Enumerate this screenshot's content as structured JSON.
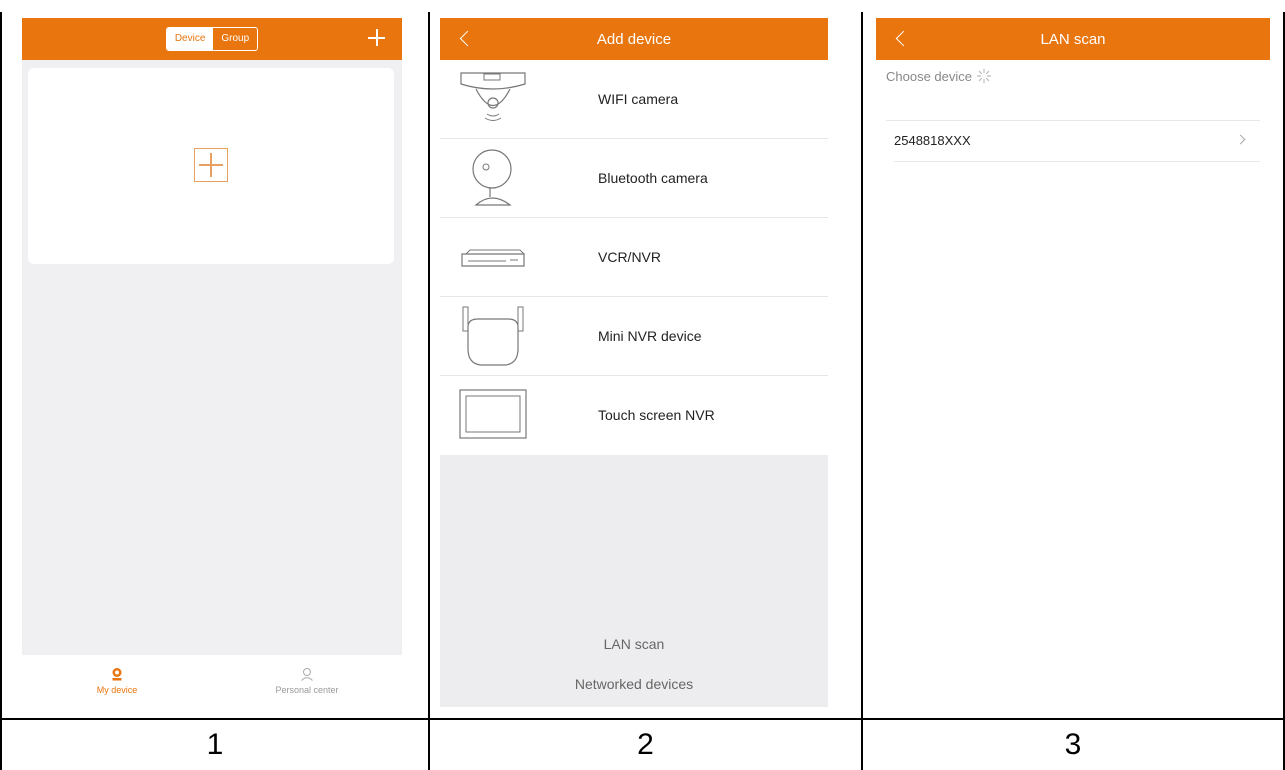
{
  "screen1": {
    "segment": {
      "device": "Device",
      "group": "Group"
    },
    "tabs": {
      "my_device": "My device",
      "personal_center": "Personal center"
    }
  },
  "screen2": {
    "title": "Add device",
    "devices": [
      {
        "label": "WIFI camera",
        "icon": "wifi-camera-icon"
      },
      {
        "label": "Bluetooth camera",
        "icon": "bluetooth-camera-icon"
      },
      {
        "label": "VCR/NVR",
        "icon": "vcr-nvr-icon"
      },
      {
        "label": "Mini NVR device",
        "icon": "mini-nvr-icon"
      },
      {
        "label": "Touch screen NVR",
        "icon": "touch-screen-nvr-icon"
      }
    ],
    "lan_scan": "LAN scan",
    "networked_devices": "Networked devices"
  },
  "screen3": {
    "title": "LAN scan",
    "choose_device": "Choose device",
    "device_id": "2548818XXX"
  },
  "captions": [
    "1",
    "2",
    "3"
  ],
  "colors": {
    "accent": "#e8750e",
    "background": "#f0f0f2"
  }
}
